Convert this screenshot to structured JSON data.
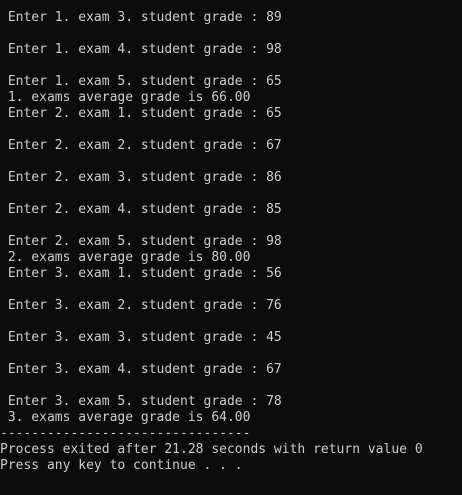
{
  "console": {
    "lines": [
      " Enter 1. exam 3. student grade : 89",
      "",
      " Enter 1. exam 4. student grade : 98",
      "",
      " Enter 1. exam 5. student grade : 65",
      " 1. exams average grade is 66.00",
      " Enter 2. exam 1. student grade : 65",
      "",
      " Enter 2. exam 2. student grade : 67",
      "",
      " Enter 2. exam 3. student grade : 86",
      "",
      " Enter 2. exam 4. student grade : 85",
      "",
      " Enter 2. exam 5. student grade : 98",
      " 2. exams average grade is 80.00",
      " Enter 3. exam 1. student grade : 56",
      "",
      " Enter 3. exam 2. student grade : 76",
      "",
      " Enter 3. exam 3. student grade : 45",
      "",
      " Enter 3. exam 4. student grade : 67",
      "",
      " Enter 3. exam 5. student grade : 78",
      " 3. exams average grade is 64.00",
      "--------------------------------",
      "Process exited after 21.28 seconds with return value 0",
      "Press any key to continue . . ."
    ]
  }
}
